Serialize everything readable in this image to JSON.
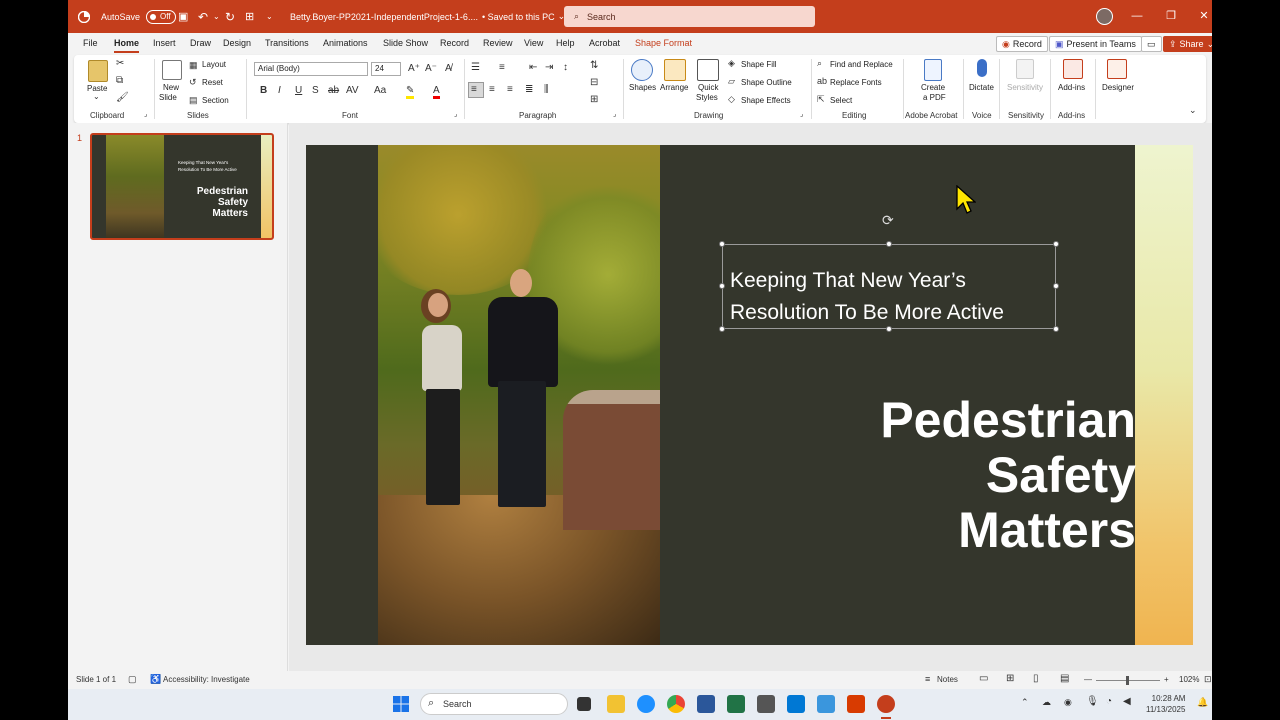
{
  "titlebar": {
    "autosave_label": "AutoSave",
    "autosave_state": "Off",
    "filename": "Betty.Boyer-PP2021-IndependentProject-1-6....",
    "saved_status": "• Saved to this PC",
    "search_placeholder": "Search"
  },
  "tabs": [
    "File",
    "Home",
    "Insert",
    "Draw",
    "Design",
    "Transitions",
    "Animations",
    "Slide Show",
    "Record",
    "Review",
    "View",
    "Help",
    "Acrobat",
    "Shape Format"
  ],
  "active_tab": "Home",
  "tabs_right": {
    "record": "Record",
    "present_teams": "Present in Teams",
    "share": "Share"
  },
  "ribbon": {
    "clipboard": {
      "paste": "Paste",
      "label": "Clipboard"
    },
    "slides": {
      "new_slide_1": "New",
      "new_slide_2": "Slide",
      "layout": "Layout",
      "reset": "Reset",
      "section": "Section",
      "label": "Slides"
    },
    "font": {
      "font_name": "Arial (Body)",
      "font_size": "24",
      "label": "Font"
    },
    "paragraph": {
      "label": "Paragraph"
    },
    "drawing": {
      "shapes": "Shapes",
      "arrange": "Arrange",
      "quick_styles_1": "Quick",
      "quick_styles_2": "Styles",
      "shape_fill": "Shape Fill",
      "shape_outline": "Shape Outline",
      "shape_effects": "Shape Effects",
      "label": "Drawing"
    },
    "editing": {
      "find_replace": "Find and Replace",
      "replace_fonts": "Replace Fonts",
      "select": "Select",
      "label": "Editing"
    },
    "acrobat": {
      "create_pdf_1": "Create",
      "create_pdf_2": "a PDF",
      "label": "Adobe Acrobat"
    },
    "voice": {
      "dictate": "Dictate",
      "label": "Voice"
    },
    "sensitivity": {
      "sensitivity": "Sensitivity",
      "label": "Sensitivity"
    },
    "addins": {
      "addins": "Add-ins",
      "label": "Add-ins"
    },
    "designer": {
      "designer": "Designer"
    }
  },
  "thumbnail": {
    "number": "1",
    "subtitle_line1": "Keeping That New Year's",
    "subtitle_line2": "Resolution To Be More Active",
    "title_line1": "Pedestrian",
    "title_line2": "Safety",
    "title_line3": "Matters"
  },
  "slide": {
    "subtitle_line1": "Keeping That New Year’s",
    "subtitle_line2": "Resolution To Be More Active",
    "title_line1": "Pedestrian",
    "title_line2": "Safety",
    "title_line3": "Matters"
  },
  "statusbar": {
    "slide_count": "Slide 1 of 1",
    "accessibility": "Accessibility: Investigate",
    "notes": "Notes",
    "zoom": "102%"
  },
  "taskbar": {
    "search_placeholder": "Search",
    "time": "10:28 AM",
    "date": "11/13/2025"
  },
  "colors": {
    "accent": "#c43e1c",
    "slide_bg": "#34362c"
  }
}
